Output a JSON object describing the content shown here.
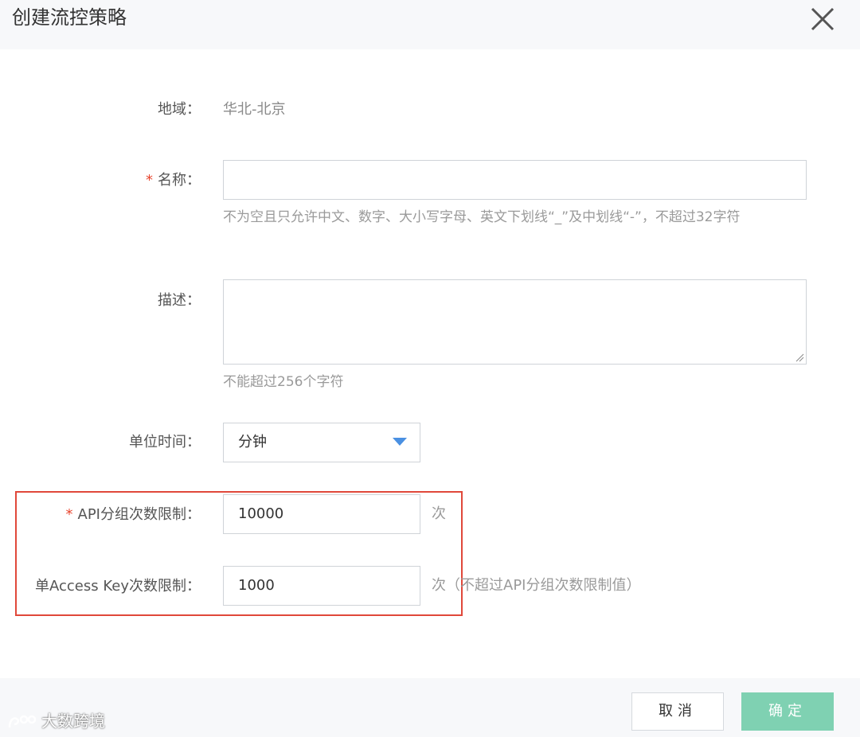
{
  "dialog": {
    "title": "创建流控策略"
  },
  "form": {
    "region": {
      "label": "地域：",
      "value": "华北-北京"
    },
    "name": {
      "required_mark": "*",
      "label": "名称：",
      "value": "",
      "help": "不为空且只允许中文、数字、大小写字母、英文下划线“_”及中划线“-”，不超过32字符"
    },
    "description": {
      "label": "描述：",
      "value": "",
      "help": "不能超过256个字符"
    },
    "unit_time": {
      "label": "单位时间：",
      "selected": "分钟"
    },
    "api_group_limit": {
      "required_mark": "*",
      "label": "API分组次数限制：",
      "value": "10000",
      "suffix": "次"
    },
    "access_key_limit": {
      "label": "单Access Key次数限制：",
      "value": "1000",
      "suffix": "次（不超过API分组次数限制值）"
    }
  },
  "footer": {
    "cancel_label": "取消",
    "ok_label": "确定"
  },
  "watermark": {
    "text": "大数跨境"
  },
  "colors": {
    "required": "#e8462f",
    "primary_button": "#7fd1b2",
    "highlight_border": "#e0483a",
    "caret": "#4a90e2"
  },
  "icons": {
    "close": "close-icon",
    "dropdown": "caret-down-icon",
    "resize": "resize-handle-icon",
    "watermark_logo": "brand-logo-icon"
  }
}
